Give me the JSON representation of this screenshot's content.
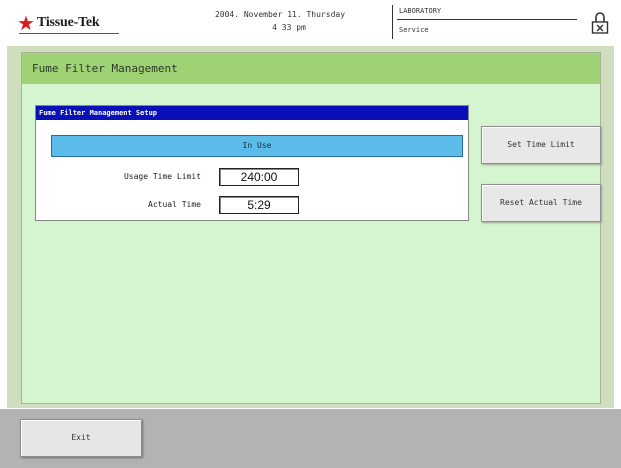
{
  "header": {
    "logo": {
      "star": "★",
      "text": "Tissue-Tek"
    },
    "datetime": {
      "date": "2004. November 11. Thursday",
      "time": "4 33 pm"
    },
    "location": {
      "line1": "LABORATORY",
      "line2": "Service"
    },
    "lock_icon": "padlock-icon"
  },
  "panel": {
    "title": "Fume Filter Management",
    "setup": {
      "header": "Fume Filter Management Setup",
      "status": "In Use",
      "usage_time_limit": {
        "label": "Usage Time Limit",
        "value": "240:00"
      },
      "actual_time": {
        "label": "Actual Time",
        "value": "5:29"
      }
    },
    "buttons": {
      "set_time_limit": "Set Time Limit",
      "reset_actual_time": "Reset Actual Time"
    }
  },
  "footer": {
    "exit": "Exit"
  },
  "colors": {
    "logo_star": "#d81b1b",
    "title_bar": "#9fd274",
    "panel_bg": "#d4f5cf",
    "setup_header": "#0a10b8",
    "status_bar": "#5bbcea",
    "footer_bg": "#b3b3b3"
  }
}
